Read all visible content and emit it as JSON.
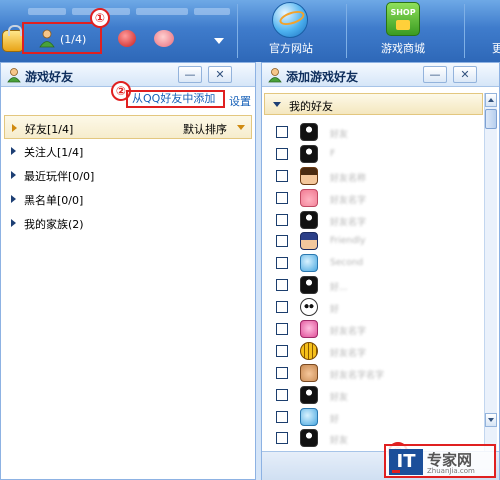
{
  "toolbar": {
    "friend_count": "(1/4)",
    "nav": [
      {
        "label": "官方网站",
        "icon": "globe-icon"
      },
      {
        "label": "游戏商城",
        "icon": "shop-icon",
        "icon_text": "SHOP"
      }
    ],
    "edge_glyph": "更"
  },
  "markers": [
    "①",
    "②",
    "③"
  ],
  "left_panel": {
    "title": "游戏好友",
    "minimize": "—",
    "close": "✕",
    "import_link": "从QQ好友中添加",
    "settings_link": "设置",
    "groups": [
      {
        "label": "好友[1/4]",
        "selected": true
      },
      {
        "label": "关注人[1/4]"
      },
      {
        "label": "最近玩伴[0/0]"
      },
      {
        "label": "黑名单[0/0]"
      },
      {
        "label": "我的家族(2)"
      }
    ],
    "sort_label": "默认排序"
  },
  "right_panel": {
    "title": "添加游戏好友",
    "minimize": "—",
    "close": "✕",
    "section_label": "我的好友",
    "friends": [
      {
        "name": "好友",
        "avatar": "penguin"
      },
      {
        "name": "F",
        "avatar": "penguin"
      },
      {
        "name": "好友名称",
        "avatar": "girl"
      },
      {
        "name": "好友名字",
        "avatar": "pig"
      },
      {
        "name": "好友名字",
        "avatar": "penguin"
      },
      {
        "name": "Friendly",
        "avatar": "anime"
      },
      {
        "name": "Second",
        "avatar": "dolphin"
      },
      {
        "name": "好...",
        "avatar": "penguin"
      },
      {
        "name": "好",
        "avatar": "panda"
      },
      {
        "name": "好友名字",
        "avatar": "pink"
      },
      {
        "name": "好友名字",
        "avatar": "tiger"
      },
      {
        "name": "好友名字名字",
        "avatar": "face"
      },
      {
        "name": "好友",
        "avatar": "penguin"
      },
      {
        "name": "好",
        "avatar": "dolphin"
      },
      {
        "name": "好友",
        "avatar": "penguin"
      }
    ]
  },
  "watermark": {
    "logo": "IT",
    "text": "专家网",
    "url": "ZhuanJia.com"
  },
  "colors": {
    "highlight": "#e02020",
    "toolbar": "#3f7ccc",
    "link": "#1660b8",
    "selected_row": "#f6eccc"
  }
}
